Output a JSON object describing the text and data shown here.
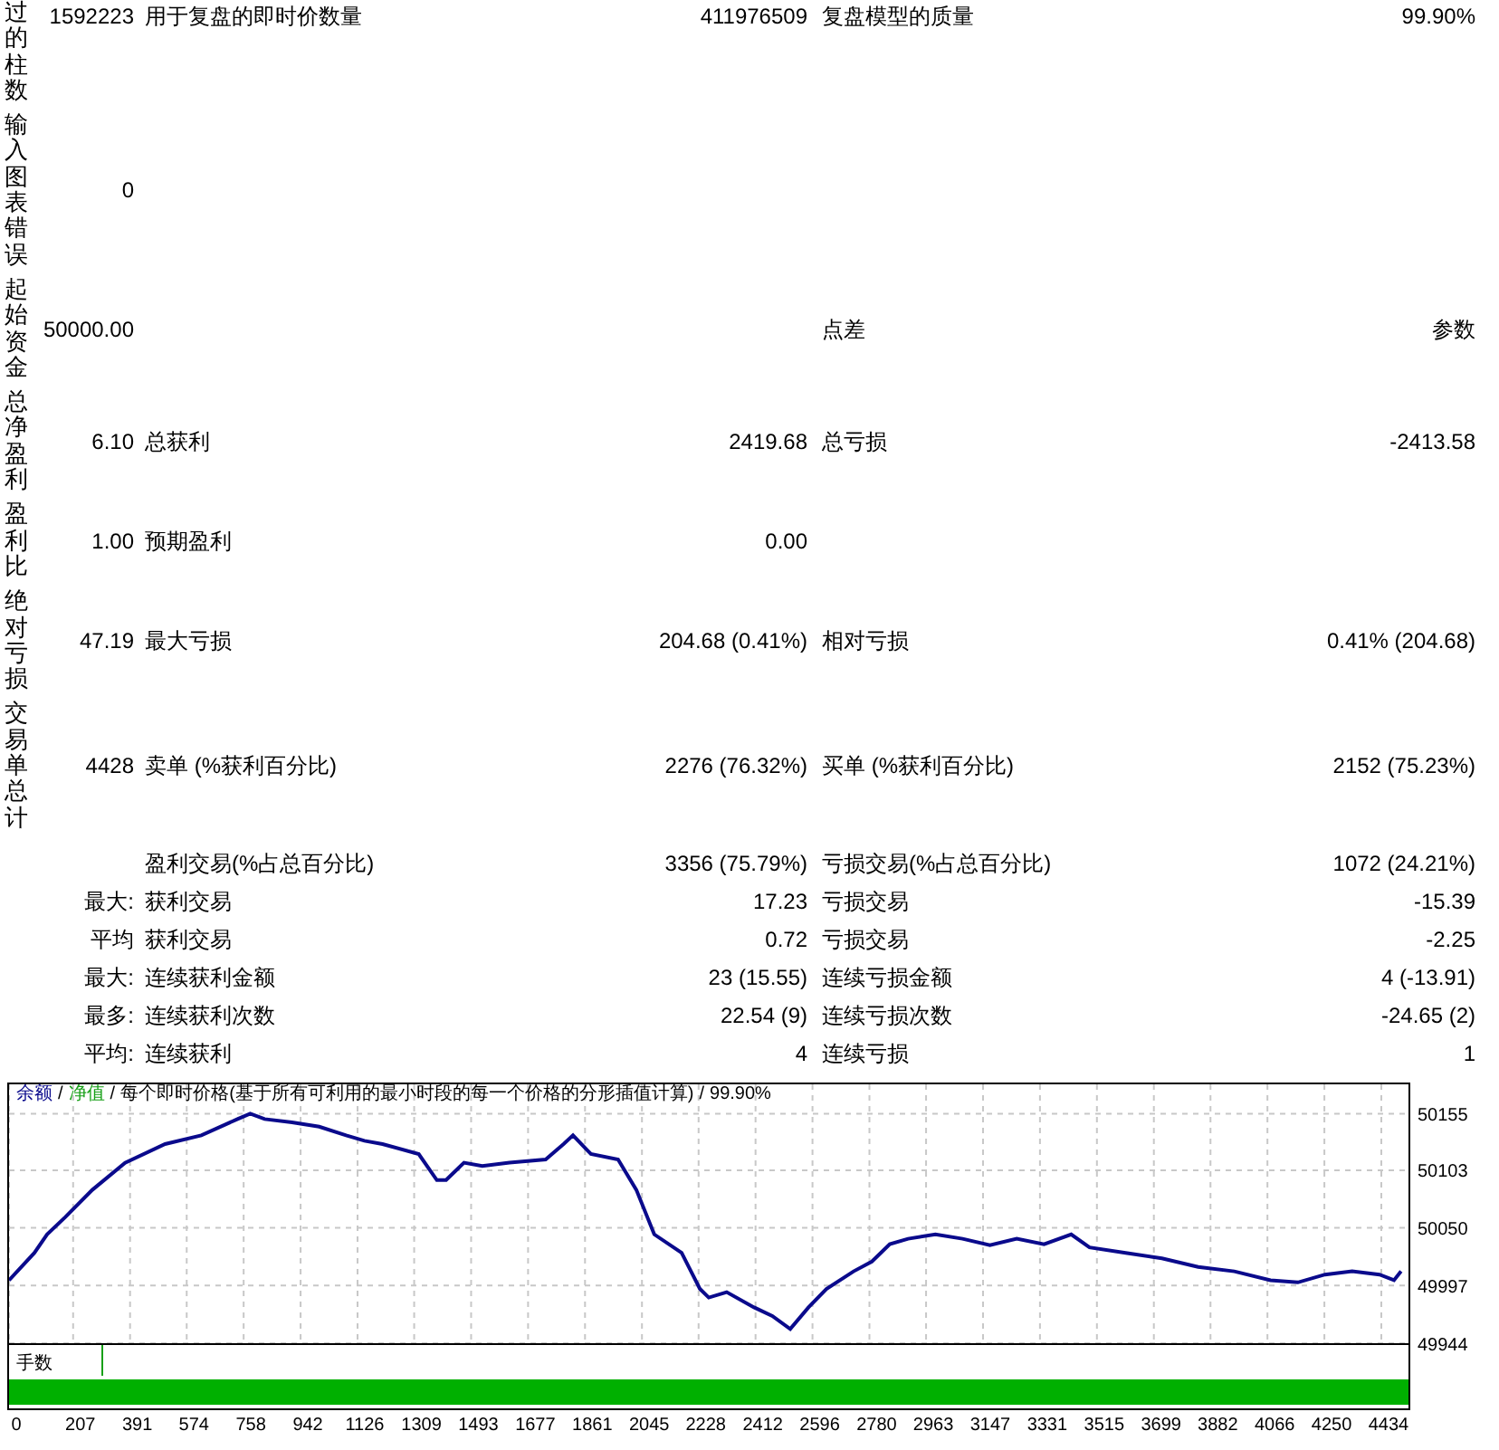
{
  "summary_rows": [
    {
      "side_label": "过的柱数",
      "value": "1592223",
      "label_2": "用于复盘的即时价数量",
      "value_2": "411976509",
      "label_3": "复盘模型的质量",
      "value_3": "99.90%"
    },
    {
      "side_label": "输入图表错误",
      "value": "0"
    },
    {
      "side_label": "起始资金",
      "value": "50000.00",
      "label_3": "点差",
      "value_3": "参数"
    },
    {
      "side_label": "总净盈利",
      "value": "6.10",
      "label_2": "总获利",
      "value_2": "2419.68",
      "label_3": "总亏损",
      "value_3": "-2413.58"
    },
    {
      "side_label": "盈利比",
      "value": "1.00",
      "label_2": "预期盈利",
      "value_2": "0.00"
    },
    {
      "side_label": "绝对亏损",
      "value": "47.19",
      "label_2": "最大亏损",
      "value_2": "204.68 (0.41%)",
      "label_3": "相对亏损",
      "value_3": "0.41% (204.68)"
    },
    {
      "side_label": "交易单总计",
      "value": "4428",
      "label_2": "卖单 (%获利百分比)",
      "value_2": "2276 (76.32%)",
      "label_3": "买单 (%获利百分比)",
      "value_3": "2152 (75.23%)"
    }
  ],
  "detail_rows": [
    {
      "label_2": "盈利交易(%占总百分比)",
      "value_2": "3356 (75.79%)",
      "label_3": "亏损交易(%占总百分比)",
      "value_3": "1072 (24.21%)"
    },
    {
      "prefix": "最大:",
      "label_2": "获利交易",
      "value_2": "17.23",
      "label_3": "亏损交易",
      "value_3": "-15.39"
    },
    {
      "prefix": "平均",
      "label_2": "获利交易",
      "value_2": "0.72",
      "label_3": "亏损交易",
      "value_3": "-2.25"
    },
    {
      "prefix": "最大:",
      "label_2": "连续获利金额",
      "value_2": "23 (15.55)",
      "label_3": "连续亏损金额",
      "value_3": "4 (-13.91)"
    },
    {
      "prefix": "最多:",
      "label_2": "连续获利次数",
      "value_2": "22.54 (9)",
      "label_3": "连续亏损次数",
      "value_3": "-24.65 (2)"
    },
    {
      "prefix": "平均:",
      "label_2": "连续获利",
      "value_2": "4",
      "label_3": "连续亏损",
      "value_3": "1"
    }
  ],
  "chart": {
    "separator": "/",
    "legend": [
      {
        "text": "净值",
        "color": "#18a018"
      },
      {
        "text": "每个即时价格(基于所有可利用的最小时段的每一个价格的分形插值计算)",
        "color": "#000000"
      },
      {
        "text": "99.90%",
        "color": "#000000"
      }
    ],
    "lots_label": "手数",
    "chart_data": {
      "type": "line",
      "x": [
        0,
        82,
        123,
        182,
        269,
        375,
        504,
        621,
        738,
        779,
        826,
        914,
        1002,
        1089,
        1148,
        1207,
        1324,
        1382,
        1412,
        1470,
        1529,
        1617,
        1734,
        1792,
        1822,
        1880,
        1968,
        2027,
        2085,
        2173,
        2232,
        2261,
        2319,
        2407,
        2466,
        2524,
        2583,
        2641,
        2729,
        2788,
        2846,
        2905,
        2993,
        3081,
        3169,
        3256,
        3344,
        3432,
        3491,
        3608,
        3725,
        3842,
        3959,
        4076,
        4164,
        4252,
        4340,
        4428,
        4475,
        4498
      ],
      "series": [
        {
          "name": "余额",
          "color": "#0a0a8c",
          "values": [
            50002,
            50027,
            50044,
            50060,
            50085,
            50110,
            50127,
            50135,
            50150,
            50155,
            50150,
            50147,
            50143,
            50135,
            50130,
            50127,
            50118,
            50094,
            50094,
            50110,
            50107,
            50110,
            50113,
            50127,
            50135,
            50118,
            50113,
            50085,
            50044,
            50027,
            49994,
            49986,
            49991,
            49977,
            49969,
            49957,
            49977,
            49994,
            50010,
            50019,
            50035,
            50040,
            50044,
            50040,
            50034,
            50040,
            50035,
            50044,
            50032,
            50027,
            50022,
            50014,
            50010,
            50002,
            50000,
            50007,
            50010,
            50007,
            50002,
            50010
          ]
        }
      ],
      "grid": true,
      "xlim": [
        0,
        4510
      ],
      "ylim": [
        49944,
        50182
      ],
      "xticks": [
        0,
        207,
        391,
        574,
        758,
        942,
        1126,
        1309,
        1493,
        1677,
        1861,
        2045,
        2228,
        2412,
        2596,
        2780,
        2963,
        3147,
        3331,
        3515,
        3699,
        3882,
        4066,
        4250,
        4434
      ],
      "yticks": [
        50155,
        50103,
        50050,
        49997,
        49944
      ]
    }
  }
}
